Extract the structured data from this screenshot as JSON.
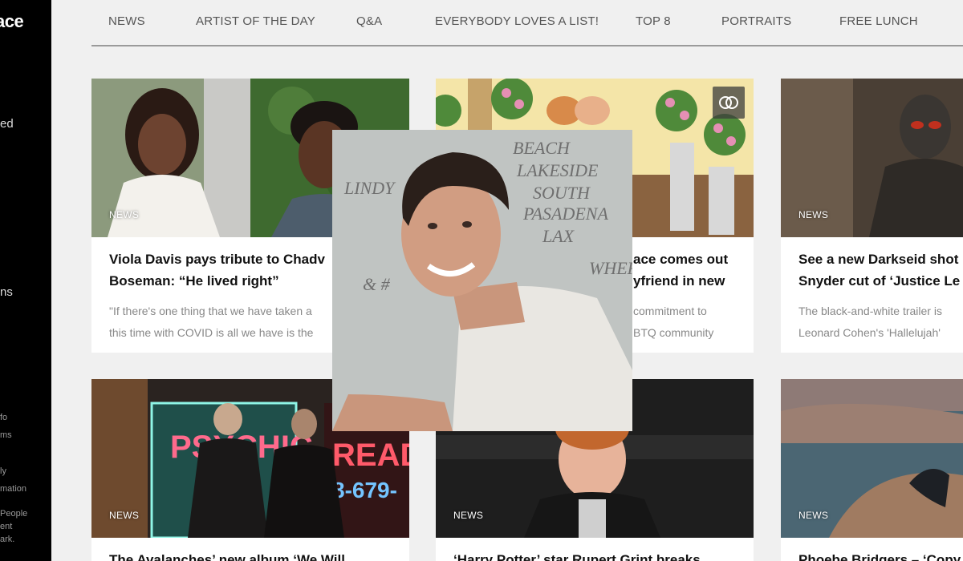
{
  "brand": {
    "logo_text": "ace"
  },
  "sidebar": {
    "items": [
      "ed",
      "ns"
    ],
    "footer_items": [
      "fo",
      "ms",
      "ly",
      "mation",
      "People",
      "ent",
      "ark."
    ]
  },
  "nav": {
    "items": [
      "NEWS",
      "ARTIST OF THE DAY",
      "Q&A",
      "EVERYBODY LOVES A LIST!",
      "TOP 8",
      "PORTRAITS",
      "FREE LUNCH"
    ]
  },
  "cards": [
    {
      "badge": "NEWS",
      "title_line1": "Viola Davis pays tribute to Chadv",
      "title_line2": "Boseman: “He lived right”",
      "excerpt_line1": "\"If there's one thing that we have taken a",
      "excerpt_line2": "this time with COVID is all we have is the"
    },
    {
      "badge": "",
      "title_line1": "ace comes out",
      "title_line2": "yfriend in new",
      "excerpt_line1": "commitment to",
      "excerpt_line2": "BTQ community"
    },
    {
      "badge": "NEWS",
      "title_line1": "See a new Darkseid shot",
      "title_line2": "Snyder cut of ‘Justice Le",
      "excerpt_line1": "The black-and-white trailer is",
      "excerpt_line2": "Leonard Cohen's 'Hallelujah'"
    },
    {
      "badge": "NEWS",
      "title_line1": "The Avalanches’ new album ‘We Will"
    },
    {
      "badge": "NEWS",
      "title_line1": "‘Harry Potter’ star Rupert Grint breaks"
    },
    {
      "badge": "NEWS",
      "title_line1": "Phoebe Bridgers – ‘Copy"
    }
  ],
  "neon_sign": {
    "left_text": "PSYCHIC",
    "right_text": "READ",
    "phone": "8-679-"
  },
  "whiteboard_text": [
    "BEACH",
    "LAKESIDE",
    "SOUTH",
    "PASADENA",
    "LAX",
    "LINDY",
    "& #",
    "WHERE"
  ]
}
